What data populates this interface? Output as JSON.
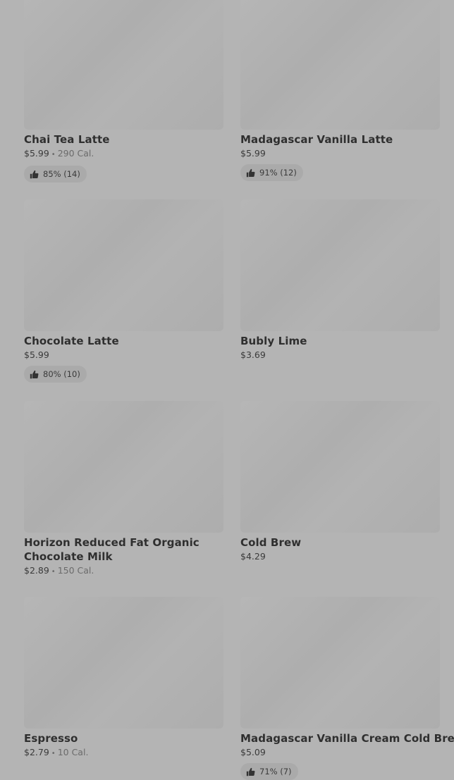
{
  "items": [
    {
      "name": "Chai Tea Latte",
      "price": "$5.99",
      "calories": "290 Cal.",
      "rating": "85% (14)"
    },
    {
      "name": "Madagascar Vanilla Latte",
      "price": "$5.99",
      "rating": "91% (12)"
    },
    {
      "name": "Chocolate Latte",
      "price": "$5.99",
      "rating": "80% (10)"
    },
    {
      "name": "Bubly Lime",
      "price": "$3.69"
    },
    {
      "name": "Horizon Reduced Fat Organic Chocolate Milk",
      "price": "$2.89",
      "calories": "150 Cal."
    },
    {
      "name": "Cold Brew",
      "price": "$4.29"
    },
    {
      "name": "Espresso",
      "price": "$2.79",
      "calories": "10 Cal."
    },
    {
      "name": "Madagascar Vanilla Cream Cold Brew",
      "price": "$5.09",
      "rating": "71% (7)"
    }
  ]
}
